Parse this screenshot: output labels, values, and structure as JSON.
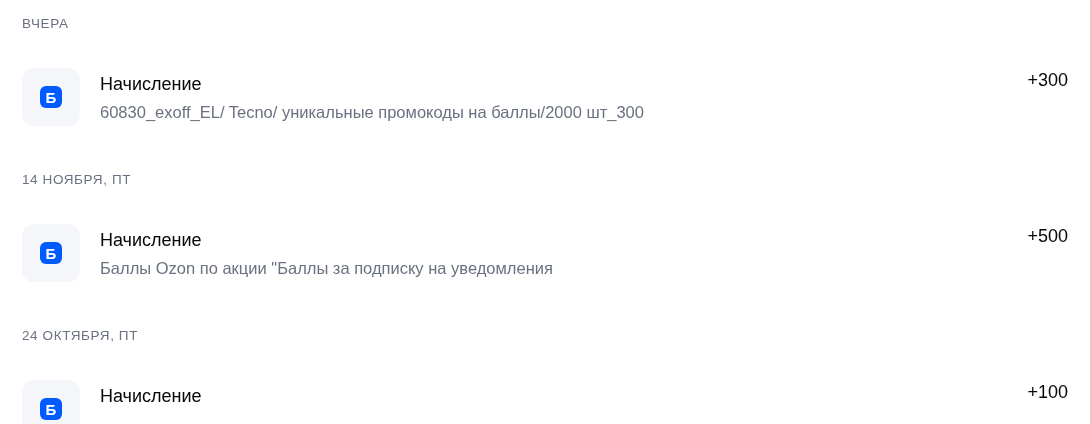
{
  "groups": [
    {
      "date": "ВЧЕРА",
      "operations": [
        {
          "badge": "Б",
          "title": "Начисление",
          "description": "60830_exoff_EL/ Tecno/ уникальные промокоды на баллы/2000 шт_300",
          "amount": "+300"
        }
      ]
    },
    {
      "date": "14 НОЯБРЯ, ПТ",
      "operations": [
        {
          "badge": "Б",
          "title": "Начисление",
          "description": "Баллы Ozon по акции \"Баллы за подписку на уведомления",
          "amount": "+500"
        }
      ]
    },
    {
      "date": "24 ОКТЯБРЯ, ПТ",
      "operations": [
        {
          "badge": "Б",
          "title": "Начисление",
          "amount": "+100"
        }
      ]
    }
  ]
}
